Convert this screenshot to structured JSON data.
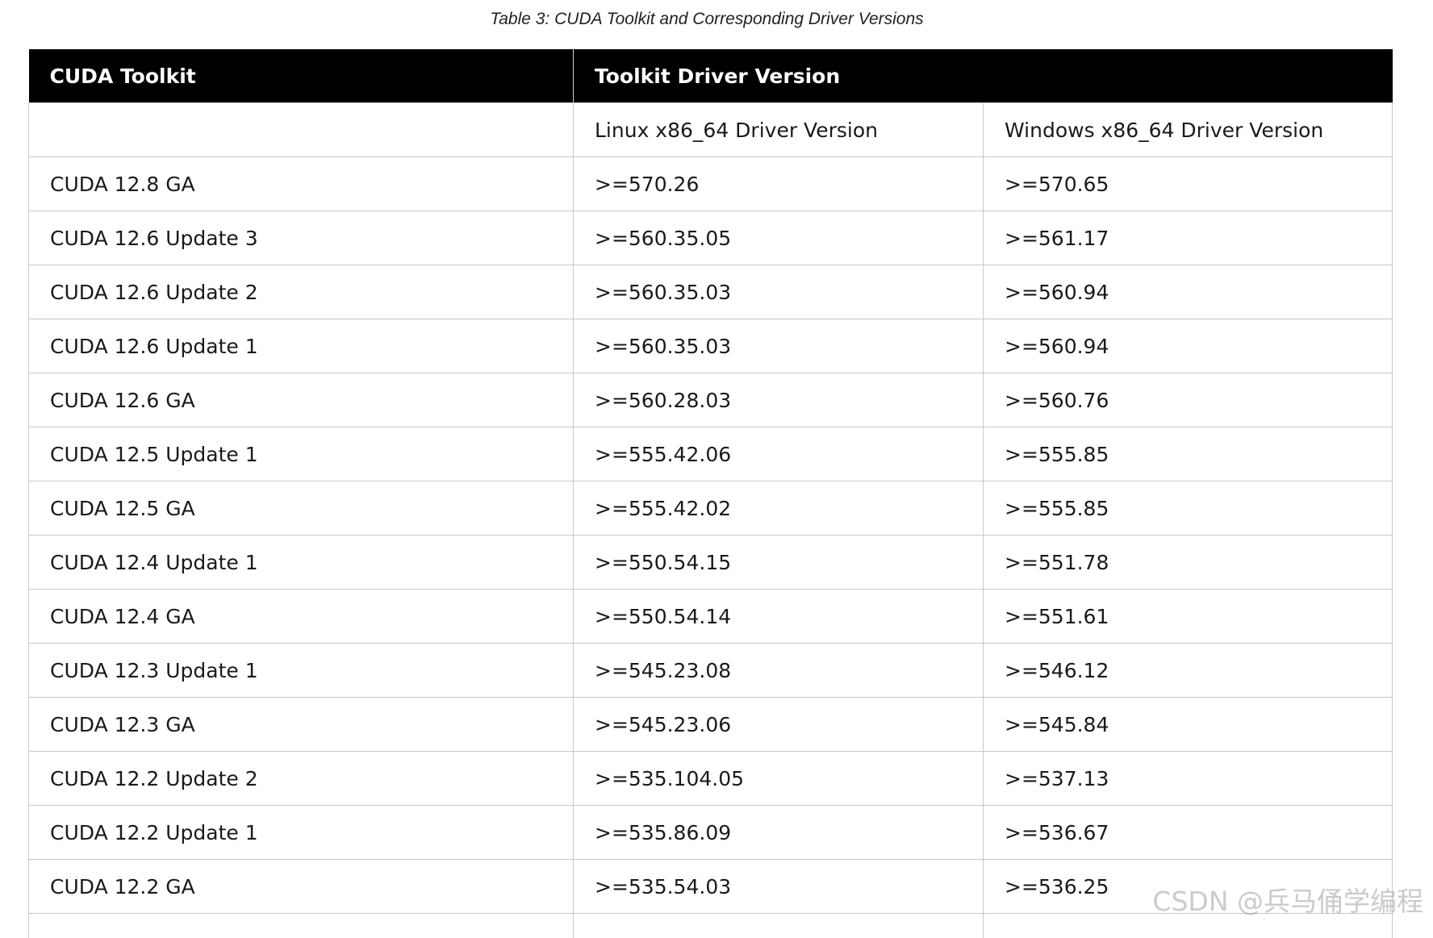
{
  "caption": "Table 3: CUDA Toolkit and Corresponding Driver Versions",
  "table": {
    "header": {
      "col1": "CUDA Toolkit",
      "col2": "Toolkit Driver Version"
    },
    "subheader": {
      "col1": "",
      "col2": "Linux x86_64 Driver Version",
      "col3": "Windows x86_64 Driver Version"
    },
    "rows": [
      {
        "toolkit": "CUDA 12.8 GA",
        "linux": ">=570.26",
        "windows": ">=570.65"
      },
      {
        "toolkit": "CUDA 12.6 Update 3",
        "linux": ">=560.35.05",
        "windows": ">=561.17"
      },
      {
        "toolkit": "CUDA 12.6 Update 2",
        "linux": ">=560.35.03",
        "windows": ">=560.94"
      },
      {
        "toolkit": "CUDA 12.6 Update 1",
        "linux": ">=560.35.03",
        "windows": ">=560.94"
      },
      {
        "toolkit": "CUDA 12.6 GA",
        "linux": ">=560.28.03",
        "windows": ">=560.76"
      },
      {
        "toolkit": "CUDA 12.5 Update 1",
        "linux": ">=555.42.06",
        "windows": ">=555.85"
      },
      {
        "toolkit": "CUDA 12.5 GA",
        "linux": ">=555.42.02",
        "windows": ">=555.85"
      },
      {
        "toolkit": "CUDA 12.4 Update 1",
        "linux": ">=550.54.15",
        "windows": ">=551.78"
      },
      {
        "toolkit": "CUDA 12.4 GA",
        "linux": ">=550.54.14",
        "windows": ">=551.61"
      },
      {
        "toolkit": "CUDA 12.3 Update 1",
        "linux": ">=545.23.08",
        "windows": ">=546.12"
      },
      {
        "toolkit": "CUDA 12.3 GA",
        "linux": ">=545.23.06",
        "windows": ">=545.84"
      },
      {
        "toolkit": "CUDA 12.2 Update 2",
        "linux": ">=535.104.05",
        "windows": ">=537.13"
      },
      {
        "toolkit": "CUDA 12.2 Update 1",
        "linux": ">=535.86.09",
        "windows": ">=536.67"
      },
      {
        "toolkit": "CUDA 12.2 GA",
        "linux": ">=535.54.03",
        "windows": ">=536.25"
      }
    ]
  },
  "watermark": "CSDN @兵马俑学编程"
}
